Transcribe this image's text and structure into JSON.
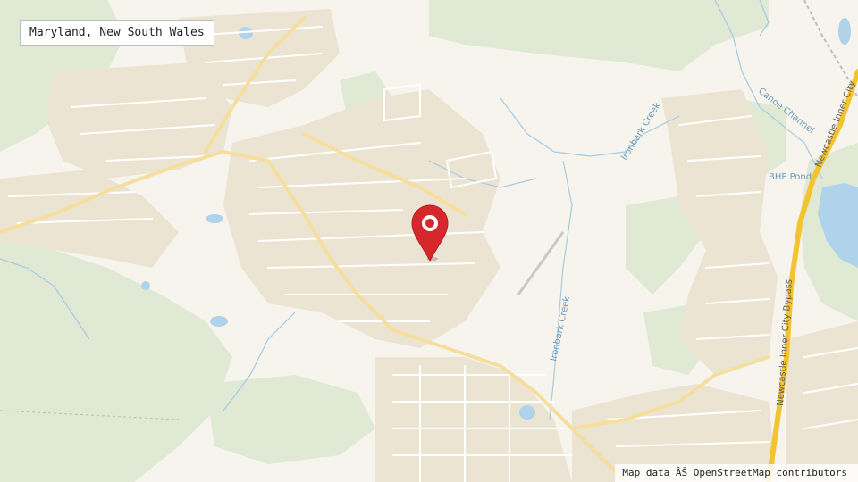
{
  "location_label": "Maryland, New South Wales",
  "attribution": "Map data ÂŠ OpenStreetMap contributors",
  "map_labels": {
    "canoe_channel": "Canoe Channel",
    "ironbark_creek_north": "Ironbark Creek",
    "ironbark_creek_south": "Ironbark Creek",
    "bhp_pond": "BHP Pond",
    "bypass_north": "Newcastle Inner City",
    "bypass_south": "Newcastle Inner City Bypass"
  },
  "marker": {
    "icon": "map-pin-icon",
    "color": "#d6272d"
  },
  "colors": {
    "background": "#f7f4ed",
    "vegetation": "#dfe9d4",
    "suburb": "#ece4d3",
    "street": "#ffffff",
    "main_road": "#f6df9d",
    "motorway": "#f4c430",
    "water": "#aed3ea",
    "waterway": "#a6cbe3"
  }
}
